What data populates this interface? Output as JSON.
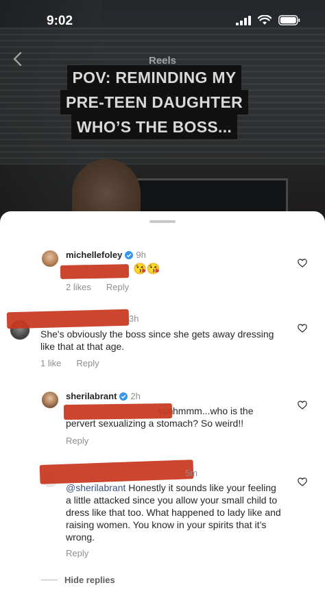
{
  "status_bar": {
    "time": "9:02"
  },
  "header": {
    "title": "Reels",
    "caption_lines": [
      "POV: REMINDING MY",
      "PRE-TEEN DAUGHTER",
      "WHO’S THE BOSS..."
    ]
  },
  "comments": [
    {
      "username": "michellefoley",
      "verified": true,
      "time": "9h",
      "text_visible": "😘😘",
      "likes": "2 likes",
      "reply_label": "Reply"
    },
    {
      "username": "",
      "time": "3h",
      "text": "She's obviously the boss since she gets away dressing like that at that age.",
      "likes": "1 like",
      "reply_label": "Reply"
    },
    {
      "username": "sherilabrant",
      "verified": true,
      "time": "2h",
      "text_prefix": "sun",
      "text": "hmmm...who is the pervert sexualizing a stomach?  So weird!!",
      "reply_label": "Reply"
    },
    {
      "username": "",
      "time": "5m",
      "mention": "@sherilabrant",
      "text": " Honestly it sounds like your feeling a little attacked since you allow your small child to dress like that too. What happened to lady like and raising women. You know in your spirits that it’s wrong.",
      "reply_label": "Reply"
    }
  ],
  "hide_replies_label": "Hide replies",
  "icons": [
    "back-chevron-icon",
    "signal-icon",
    "wifi-icon",
    "battery-icon",
    "heart-icon",
    "verified-badge-icon"
  ],
  "colors": {
    "redaction": "#c8381f",
    "link": "#385185",
    "secondary_text": "#8e8e8e",
    "verified": "#3897f0"
  }
}
